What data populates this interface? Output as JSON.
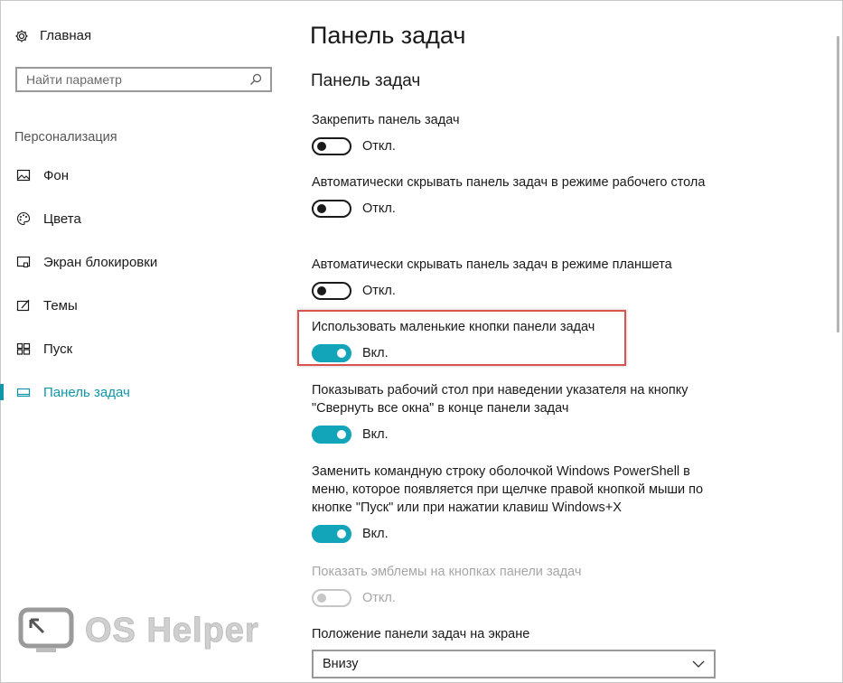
{
  "sidebar": {
    "home_label": "Главная",
    "search_placeholder": "Найти параметр",
    "section_label": "Персонализация",
    "items": [
      {
        "label": "Фон",
        "icon": "picture-icon"
      },
      {
        "label": "Цвета",
        "icon": "palette-icon"
      },
      {
        "label": "Экран блокировки",
        "icon": "lock-screen-icon"
      },
      {
        "label": "Темы",
        "icon": "themes-icon"
      },
      {
        "label": "Пуск",
        "icon": "start-icon"
      },
      {
        "label": "Панель задач",
        "icon": "taskbar-icon",
        "active": true
      }
    ]
  },
  "main": {
    "page_title": "Панель задач",
    "section_title": "Панель задач",
    "settings": [
      {
        "label": "Закрепить панель задач",
        "state": "Откл.",
        "on": false
      },
      {
        "label": "Автоматически скрывать панель задач в режиме рабочего стола",
        "state": "Откл.",
        "on": false
      },
      {
        "label": "Автоматически скрывать панель задач в режиме планшета",
        "state": "Откл.",
        "on": false
      },
      {
        "label": "Использовать маленькие кнопки панели задач",
        "state": "Вкл.",
        "on": true
      },
      {
        "label": "Показывать рабочий стол при наведении указателя на кнопку \"Свернуть все окна\" в конце панели задач",
        "state": "Вкл.",
        "on": true
      },
      {
        "label": "Заменить командную строку оболочкой Windows PowerShell в меню, которое появляется при щелчке правой кнопкой мыши по кнопке \"Пуск\" или при нажатии клавиш Windows+X",
        "state": "Вкл.",
        "on": true
      },
      {
        "label": "Показать эмблемы на кнопках панели задач",
        "state": "Откл.",
        "on": false,
        "disabled": true
      }
    ],
    "position_label": "Положение панели задач на экране",
    "position_value": "Внизу"
  },
  "watermark": {
    "text": "OS Helper"
  },
  "colors": {
    "accent": "#12a4b8",
    "highlight": "#d9534f"
  }
}
